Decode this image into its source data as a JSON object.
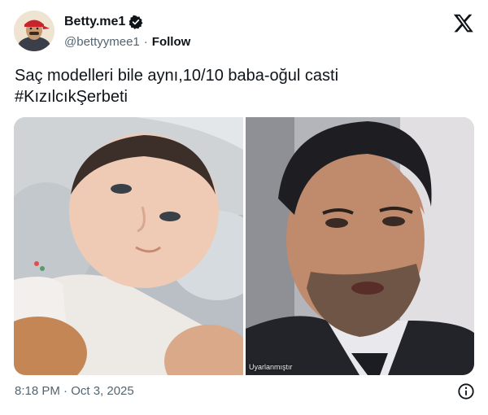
{
  "author": {
    "display_name": "Betty.me1",
    "handle": "@bettyymee1",
    "follow_label": "Follow",
    "separator": "·"
  },
  "tweet": {
    "line1": "Saç modelleri bile aynı,10/10 baba-oğul casti",
    "line2": "#KızılcıkŞerbeti"
  },
  "media": {
    "caption_right": "Uyarlanmıştır"
  },
  "footer": {
    "timestamp": "8:18 PM · Oct 3, 2025"
  },
  "icons": {
    "verified": "verified-badge-icon",
    "brand": "x-logo-icon",
    "info": "info-icon"
  },
  "colors": {
    "text_primary": "#0f1419",
    "text_secondary": "#536471",
    "background": "#ffffff"
  }
}
